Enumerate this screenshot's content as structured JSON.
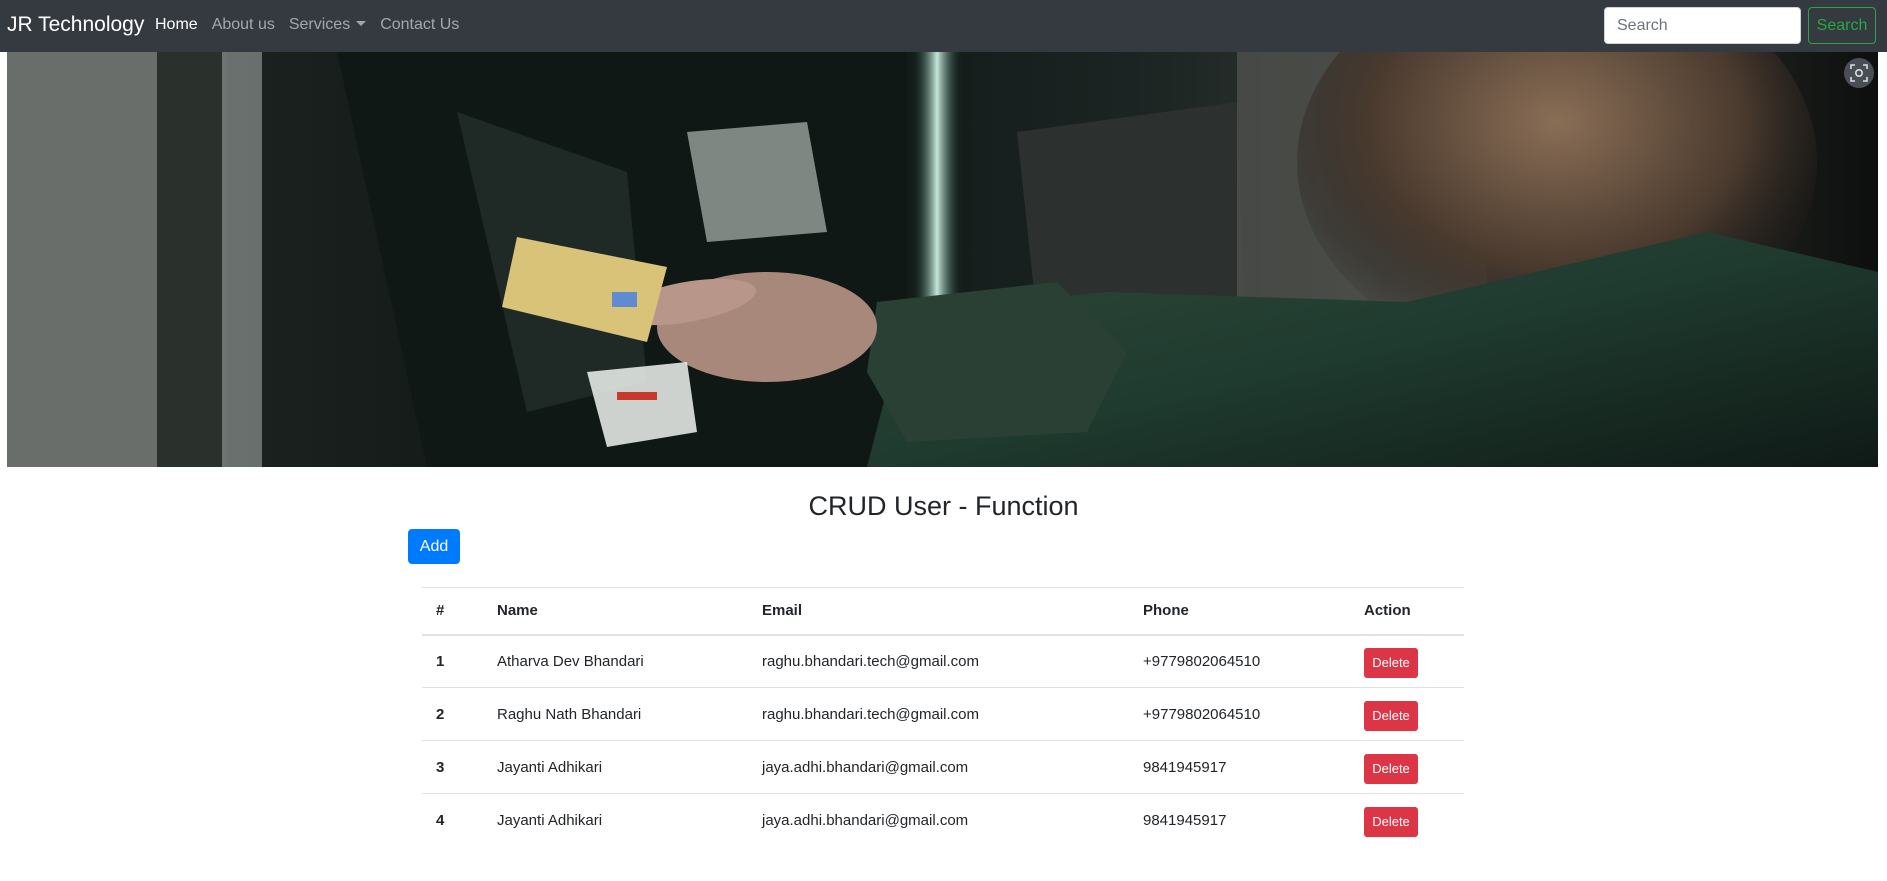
{
  "navbar": {
    "brand": "JR Technology",
    "links": [
      {
        "label": "Home",
        "active": true
      },
      {
        "label": "About us",
        "active": false
      },
      {
        "label": "Services",
        "active": false
      },
      {
        "label": "Contact Us",
        "active": false
      }
    ],
    "search_placeholder": "Search",
    "search_button": "Search"
  },
  "hero": {
    "icon": "lens-icon"
  },
  "main": {
    "title": "CRUD User - Function",
    "add_button": "Add",
    "table": {
      "headers": [
        "#",
        "Name",
        "Email",
        "Phone",
        "Action"
      ],
      "rows": [
        {
          "id": "1",
          "name": "Atharva Dev Bhandari",
          "email": "raghu.bhandari.tech@gmail.com",
          "phone": "+9779802064510",
          "action": "Delete"
        },
        {
          "id": "2",
          "name": "Raghu Nath Bhandari",
          "email": "raghu.bhandari.tech@gmail.com",
          "phone": "+9779802064510",
          "action": "Delete"
        },
        {
          "id": "3",
          "name": "Jayanti Adhikari",
          "email": "jaya.adhi.bhandari@gmail.com",
          "phone": "9841945917",
          "action": "Delete"
        },
        {
          "id": "4",
          "name": "Jayanti Adhikari",
          "email": "jaya.adhi.bhandari@gmail.com",
          "phone": "9841945917",
          "action": "Delete"
        }
      ]
    }
  },
  "colors": {
    "navbar_bg": "#343a40",
    "primary": "#007bff",
    "danger": "#dc3545",
    "success": "#28a745"
  }
}
